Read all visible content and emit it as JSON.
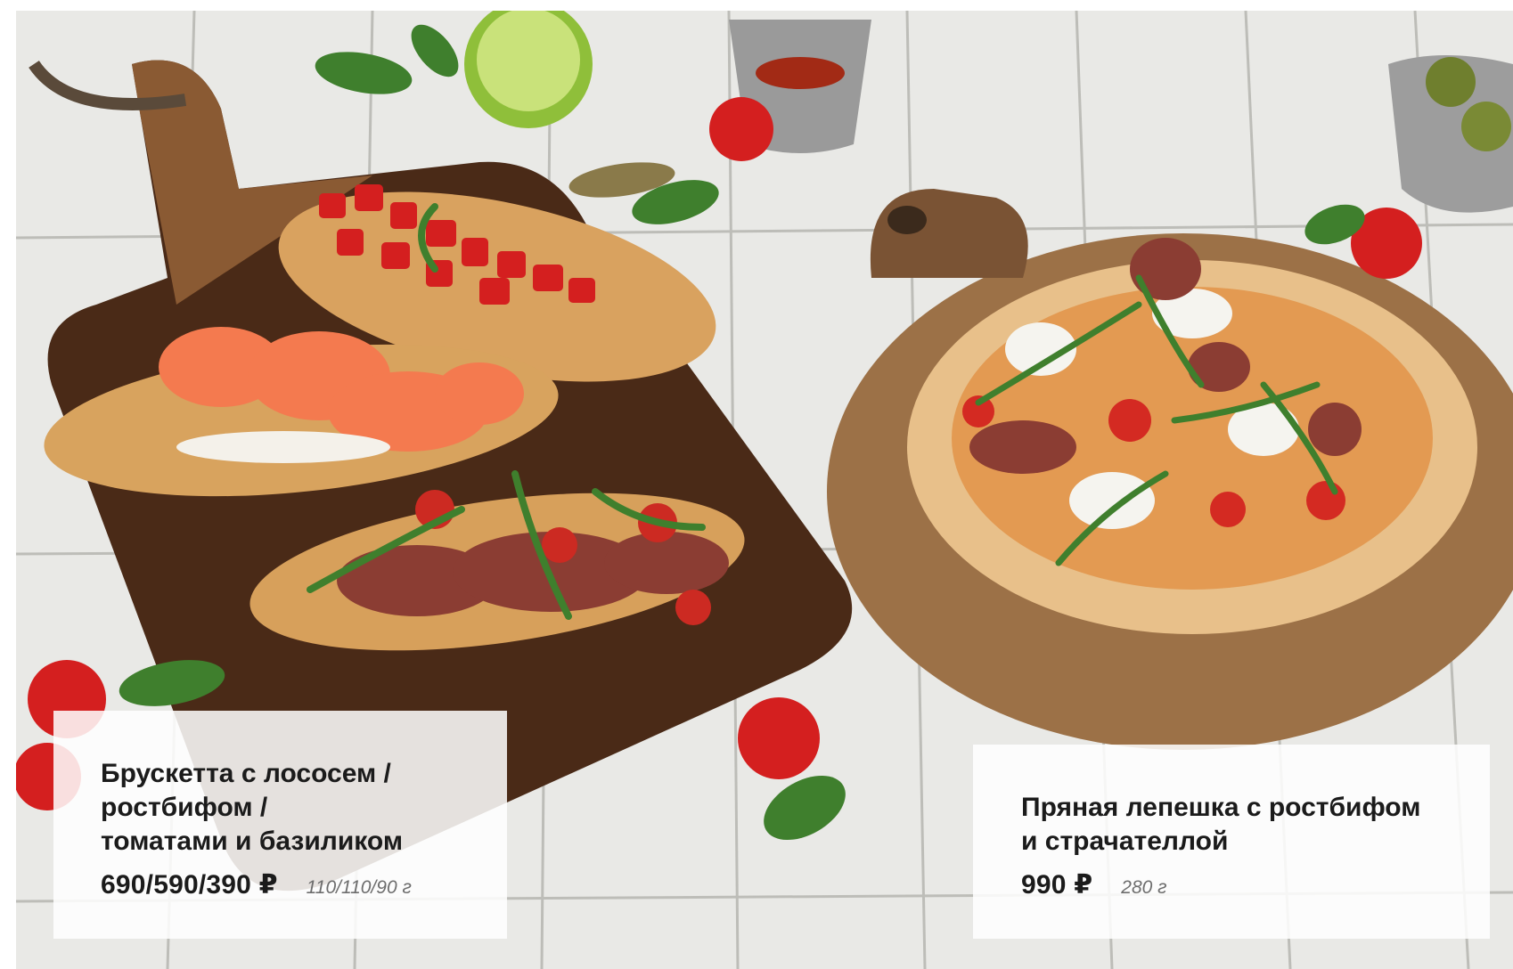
{
  "photo": {
    "description_icon": "food-photo",
    "colors": {
      "tile": "#e9e9e6",
      "grout": "#b9b9b4",
      "board_dark": "#4a2a17",
      "board_light": "#a77a4e",
      "tomato": "#d41f1f",
      "basil": "#3f7f2d",
      "salmon": "#f47a4f",
      "crust": "#e0b57a"
    }
  },
  "dishes": [
    {
      "title": "Брускетта с лососем /\nростбифом /\nтоматами и базиликом",
      "price": "690/590/390 ₽",
      "weight": "110/110/90 г"
    },
    {
      "title": "Пряная лепешка с ростбифом\nи страчателлой",
      "price": "990 ₽",
      "weight": "280 г"
    }
  ]
}
